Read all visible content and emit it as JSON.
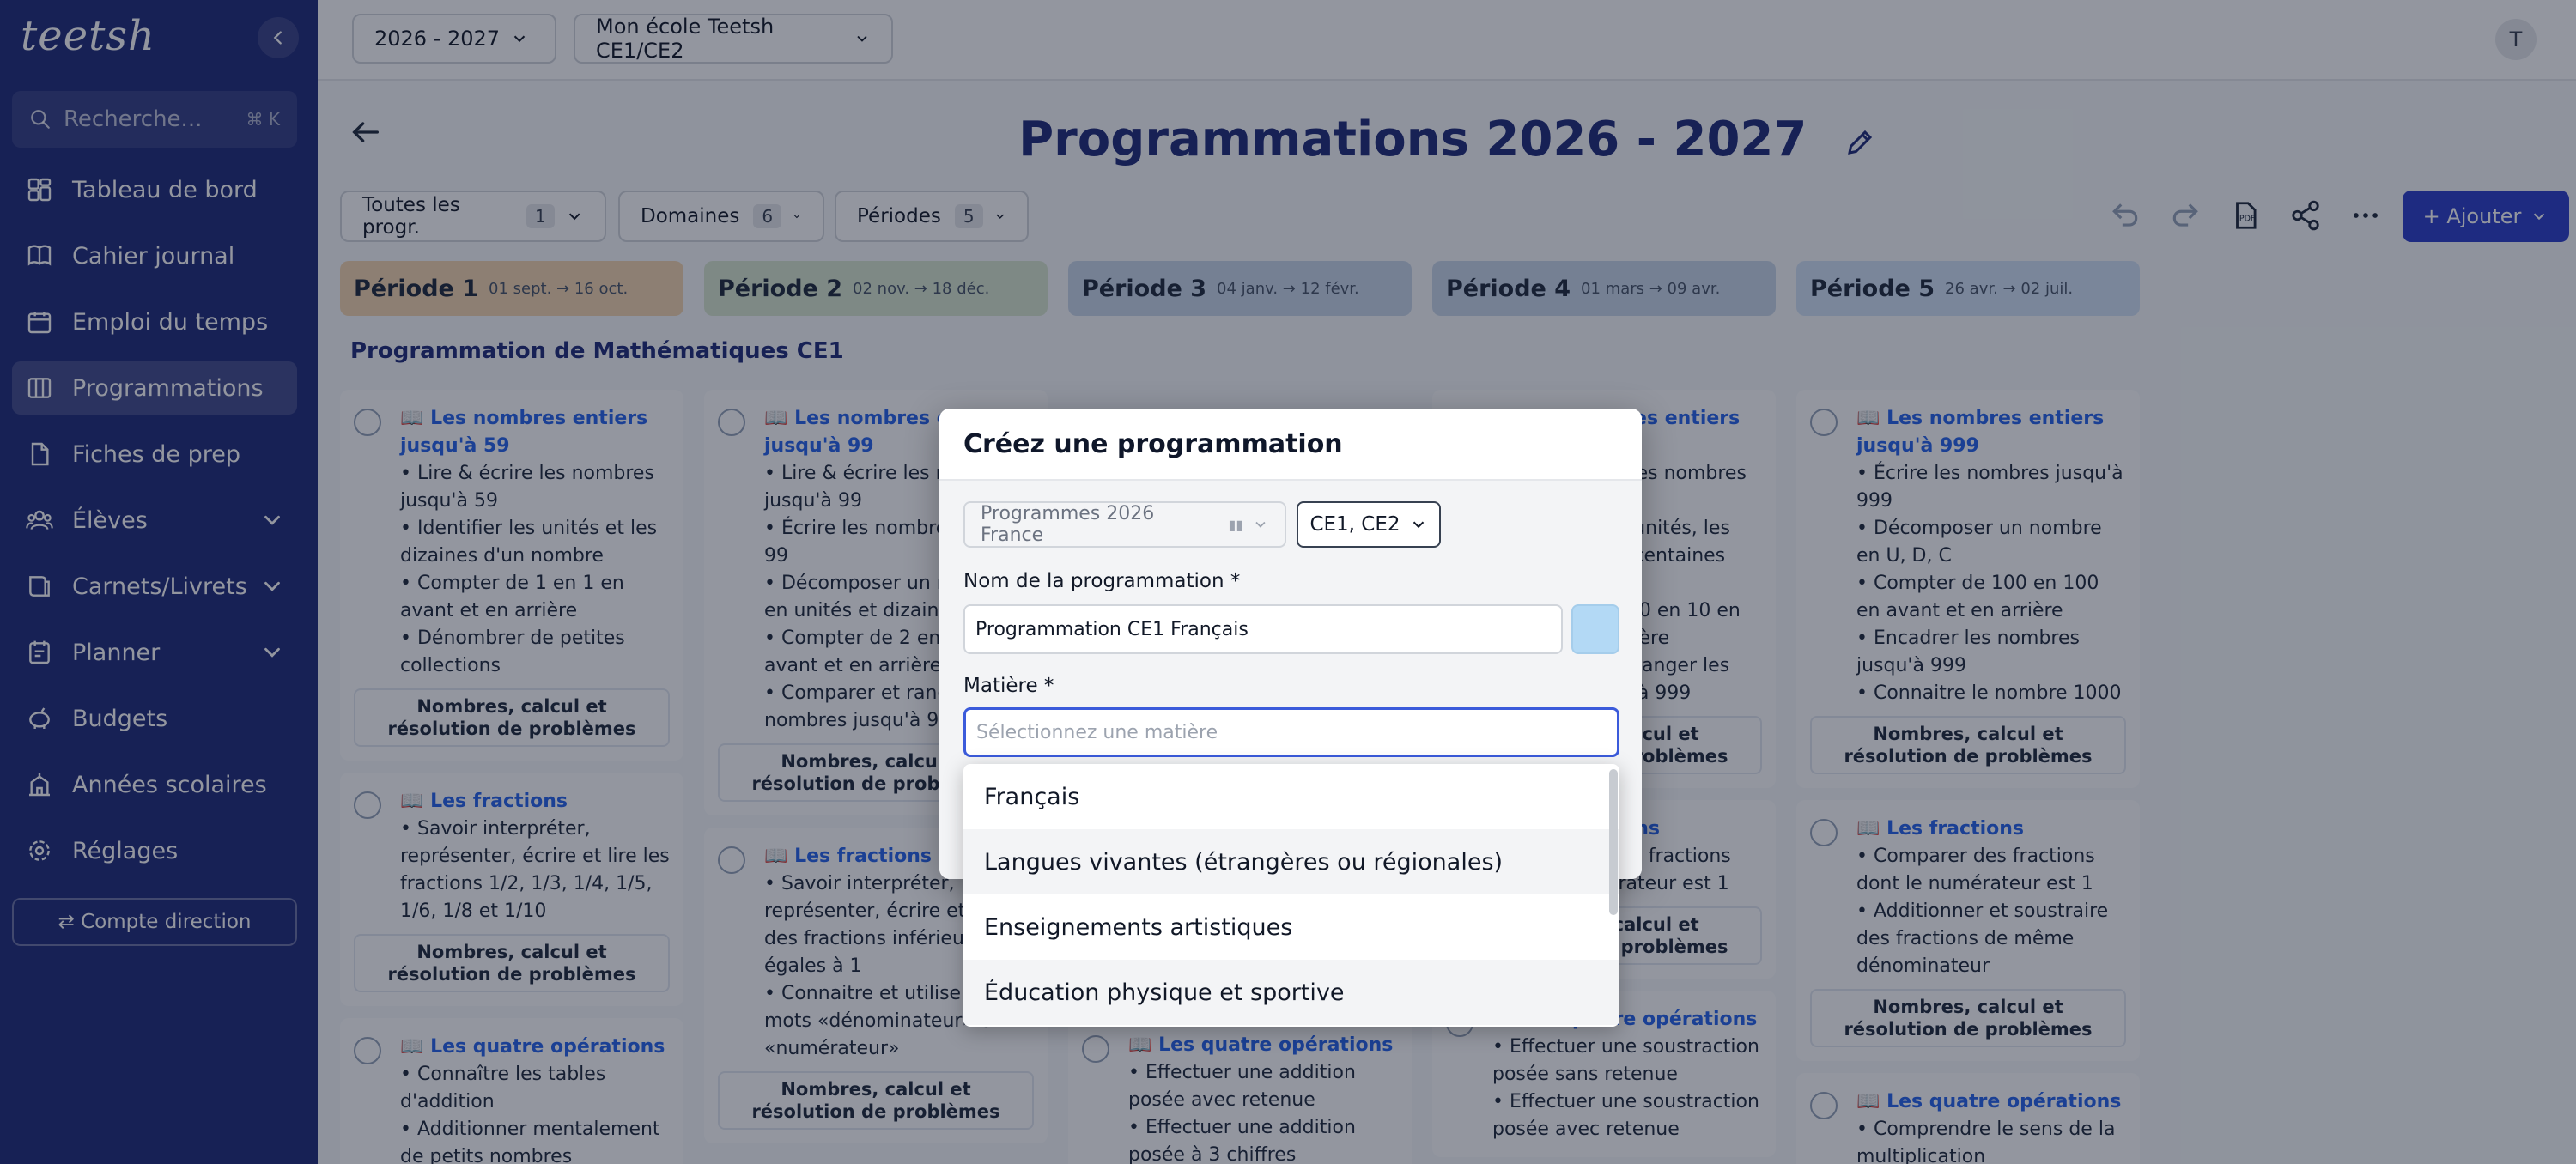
{
  "sidebar": {
    "logo": "teetsh",
    "search": {
      "placeholder": "Recherche...",
      "shortcut": "⌘ K"
    },
    "items": [
      {
        "label": "Tableau de bord",
        "icon": "dashboard-icon"
      },
      {
        "label": "Cahier journal",
        "icon": "book-icon"
      },
      {
        "label": "Emploi du temps",
        "icon": "calendar-icon"
      },
      {
        "label": "Programmations",
        "icon": "layout-icon",
        "active": true
      },
      {
        "label": "Fiches de prep",
        "icon": "file-icon"
      },
      {
        "label": "Élèves",
        "icon": "users-icon",
        "expandable": true
      },
      {
        "label": "Carnets/Livrets",
        "icon": "notebook-icon",
        "expandable": true
      },
      {
        "label": "Planner",
        "icon": "planner-icon",
        "expandable": true
      },
      {
        "label": "Budgets",
        "icon": "piggy-bank-icon"
      },
      {
        "label": "Années scolaires",
        "icon": "school-icon"
      },
      {
        "label": "Réglages",
        "icon": "gear-icon"
      }
    ],
    "direction_button": "⇄ Compte direction"
  },
  "topbar": {
    "year_select": "2026 - 2027",
    "school_select": "Mon école Teetsh CE1/CE2",
    "avatar_initial": "T"
  },
  "page": {
    "title": "Programmations 2026 - 2027",
    "filters": [
      {
        "label": "Toutes les progr.",
        "count": "1"
      },
      {
        "label": "Domaines",
        "count": "6"
      },
      {
        "label": "Périodes",
        "count": "5"
      }
    ],
    "add_button": "+ Ajouter",
    "section_title": "Programmation de Mathématiques CE1",
    "periods": [
      {
        "name": "Période 1",
        "dates": "01 sept. → 16 oct.",
        "color": "#f4d6b0"
      },
      {
        "name": "Période 2",
        "dates": "02 nov. → 18 déc.",
        "color": "#d9e8cf"
      },
      {
        "name": "Période 3",
        "dates": "04 janv. → 12 févr.",
        "color": "#c9d7ea"
      },
      {
        "name": "Période 4",
        "dates": "01 mars → 09 avr.",
        "color": "#c9d7ea"
      },
      {
        "name": "Période 5",
        "dates": "26 avr. → 02 juil.",
        "color": "#d2e2f6"
      }
    ],
    "columns": [
      [
        {
          "title": "Les nombres entiers jusqu'à 59",
          "items": [
            "Lire & écrire les nombres jusqu'à 59",
            "Identifier les unités et les dizaines d'un nombre",
            "Compter de 1 en 1 en avant et en arrière",
            "Dénombrer de petites collections"
          ],
          "domain": "Nombres, calcul et résolution de problèmes"
        },
        {
          "title": "Les fractions",
          "items": [
            "Savoir interpréter, représenter, écrire et lire les fractions 1/2, 1/3, 1/4, 1/5, 1/6, 1/8 et 1/10"
          ],
          "domain": "Nombres, calcul et résolution de problèmes"
        },
        {
          "title": "Les quatre opérations",
          "items": [
            "Connaître les tables d'addition",
            "Additionner mentalement de petits nombres"
          ],
          "domain": ""
        }
      ],
      [
        {
          "title": "Les nombres entiers jusqu'à 99",
          "items": [
            "Lire & écrire les nombres jusqu'à 99",
            "Écrire les nombres jusqu'à 99",
            "Décomposer un nombre en unités et dizaines",
            "Compter de 2 en 2 en avant et en arrière",
            "Comparer et ranger des nombres jusqu'à 99"
          ],
          "domain": "Nombres, calcul et résolution de problèmes"
        },
        {
          "title": "Les fractions",
          "items": [
            "Savoir interpréter, représenter, écrire et lire des fractions inférieures ou égales à 1",
            "Connaitre et utiliser les mots «dénominateur» et «numérateur»"
          ],
          "domain": "Nombres, calcul et résolution de problèmes"
        }
      ],
      [
        {
          "title": "Les quatre opérations",
          "items": [
            "Effectuer une addition posée avec retenue",
            "Effectuer une addition posée à 3 chiffres"
          ],
          "domain": ""
        }
      ],
      [
        {
          "title": "Les nombres entiers jusqu'à 999",
          "items": [
            "Lire & écrire les nombres jusqu'à 999",
            "Identifier les unités, les dizaines et les centaines d'un nombre",
            "Compter de 10 en 10 en avant et en arrière",
            "Comparer et ranger les nombres jusqu'à 999"
          ],
          "domain": "Nombres, calcul et résolution de problèmes"
        },
        {
          "title": "Les fractions",
          "items": [
            "Comparer des fractions dont le numérateur est 1"
          ],
          "domain": "Nombres, calcul et résolution de problèmes"
        },
        {
          "title": "Les quatre opérations",
          "items": [
            "Effectuer une soustraction posée sans retenue",
            "Effectuer une soustraction posée avec retenue"
          ],
          "domain": ""
        }
      ],
      [
        {
          "title": "Les nombres entiers jusqu'à 999",
          "items": [
            "Écrire les nombres jusqu'à 999",
            "Décomposer un nombre en U, D, C",
            "Compter de 100 en 100 en avant et en arrière",
            "Encadrer les nombres jusqu'à 999",
            "Connaitre le nombre 1000"
          ],
          "domain": "Nombres, calcul et résolution de problèmes"
        },
        {
          "title": "Les fractions",
          "items": [
            "Comparer des fractions dont le numérateur est 1",
            "Additionner et soustraire des fractions de même dénominateur"
          ],
          "domain": "Nombres, calcul et résolution de problèmes"
        },
        {
          "title": "Les quatre opérations",
          "items": [
            "Comprendre le sens de la multiplication"
          ],
          "domain": ""
        }
      ]
    ]
  },
  "modal": {
    "title": "Créez une programmation",
    "program_select": "Programmes 2026 France",
    "level_select": "CE1, CE2",
    "name_label": "Nom de la programmation *",
    "name_value": "Programmation CE1 Français",
    "swatch_color": "#b3d9f5",
    "matiere_label": "Matière *",
    "matiere_placeholder": "Sélectionnez une matière",
    "options": [
      "Français",
      "Langues vivantes (étrangères ou régionales)",
      "Enseignements artistiques",
      "Éducation physique et sportive"
    ]
  }
}
